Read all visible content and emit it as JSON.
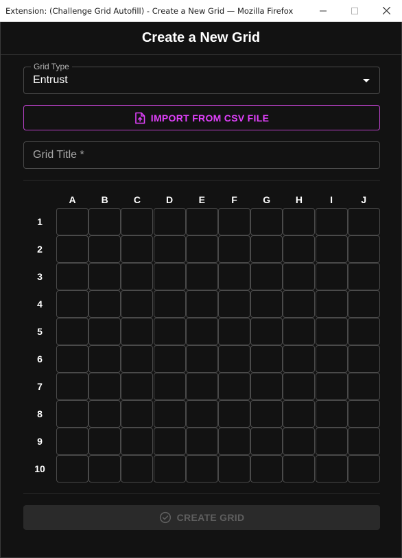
{
  "window": {
    "title": "Extension: (Challenge Grid Autofill) - Create a New Grid — Mozilla Firefox",
    "controls": [
      "minimize-icon",
      "maximize-icon",
      "close-icon"
    ]
  },
  "header": {
    "title": "Create a New Grid"
  },
  "grid_type": {
    "label": "Grid Type",
    "value": "Entrust"
  },
  "import_button": {
    "label": "IMPORT FROM CSV FILE",
    "icon": "file-upload-icon"
  },
  "grid_title": {
    "placeholder": "Grid Title *",
    "value": ""
  },
  "grid": {
    "columns": [
      "A",
      "B",
      "C",
      "D",
      "E",
      "F",
      "G",
      "H",
      "I",
      "J"
    ],
    "rows": [
      "1",
      "2",
      "3",
      "4",
      "5",
      "6",
      "7",
      "8",
      "9",
      "10"
    ]
  },
  "create_button": {
    "label": "CREATE GRID",
    "icon": "check-circle-icon",
    "disabled": true
  },
  "colors": {
    "background": "#121212",
    "accent": "#e040fb",
    "border": "#4a4a4a",
    "disabled_text": "#5f5f5f"
  }
}
